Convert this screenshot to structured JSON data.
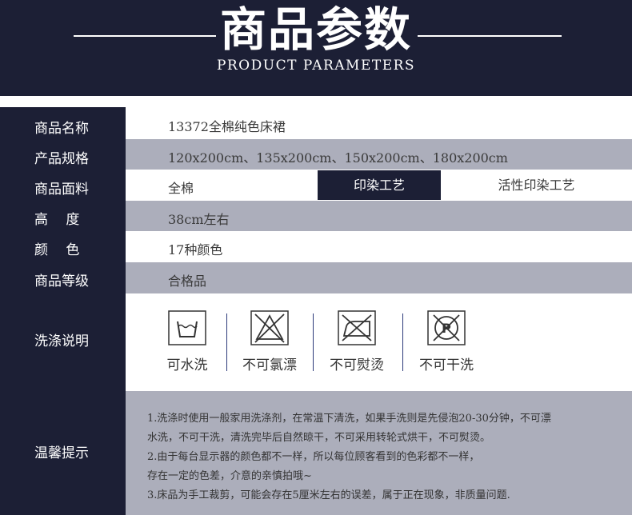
{
  "header": {
    "title": "商品参数",
    "subtitle": "PRODUCT PARAMETERS"
  },
  "params": [
    {
      "label": "商品名称",
      "value": "13372全棉纯色床裙"
    },
    {
      "label": "产品规格",
      "value": "120x200cm、135x200cm、150x200cm、180x200cm"
    },
    {
      "label": "商品面料",
      "value": "全棉",
      "mid": "印染工艺",
      "right": "活性印染工艺"
    },
    {
      "label": "高　 度",
      "value": "38cm左右"
    },
    {
      "label": "颜　 色",
      "value": "17种颜色"
    },
    {
      "label": "商品等级",
      "value": "合格品"
    }
  ],
  "care": {
    "label": "洗涤说明",
    "items": [
      {
        "icon": "washtub-icon",
        "text": "可水洗"
      },
      {
        "icon": "no-bleach-icon",
        "text": "不可氯漂"
      },
      {
        "icon": "no-iron-icon",
        "text": "不可熨烫"
      },
      {
        "icon": "no-dryclean-icon",
        "text": "不可干洗"
      }
    ]
  },
  "tips": {
    "label": "温馨提示",
    "lines": [
      "1.洗涤时使用一般家用洗涤剂，在常温下清洗，如果手洗则是先侵泡20-30分钟，不可漂",
      "   水洗，不可干洗，清洗完毕后自然晾干，不可采用转轮式烘干，不可熨烫。",
      "2.由于每台显示器的颜色都不一样，所以每位顾客看到的色彩都不一样，",
      "   存在一定的色差，介意的亲慎拍哦~",
      "3.床品为手工裁剪，可能会存在5厘米左右的误差，属于正在现象，非质量问题."
    ]
  },
  "colors": {
    "navy": "#1c1f35",
    "gray": "#acaebb"
  }
}
